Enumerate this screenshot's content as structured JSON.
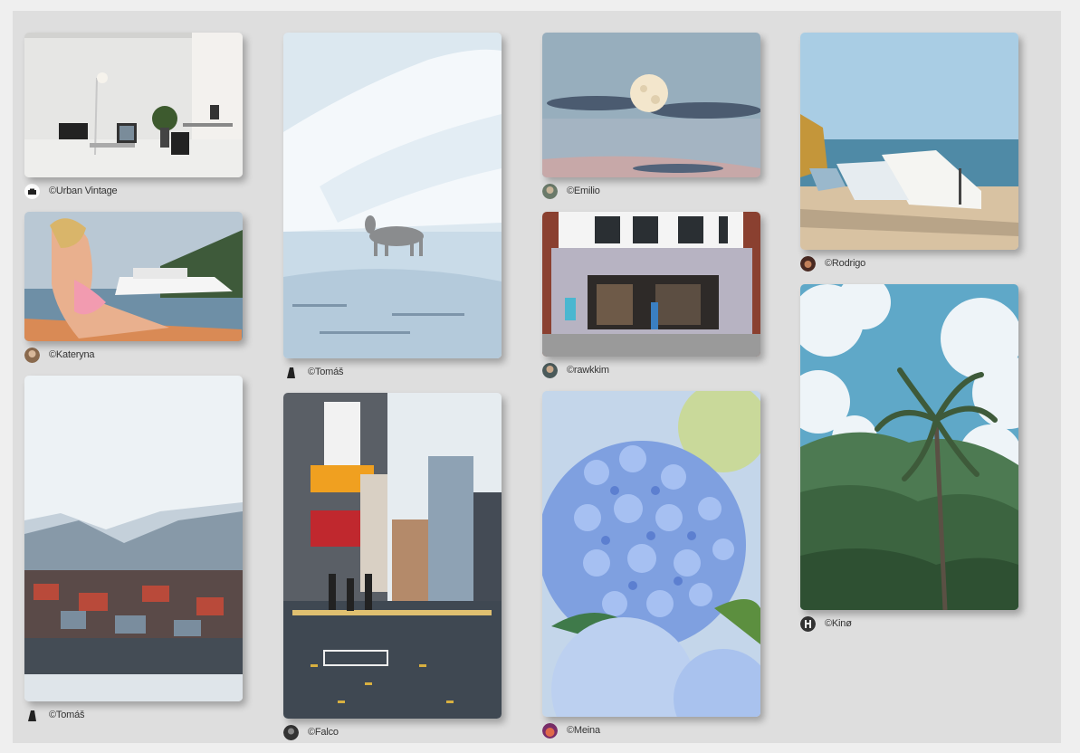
{
  "gallery": {
    "columns": [
      {
        "items": [
          {
            "alt": "White studio interior with lamp, chairs, plant and desk",
            "credit": "©Urban Vintage",
            "avatar": "camera-logo-icon"
          },
          {
            "alt": "Woman in pink bikini on boat near white yacht",
            "credit": "©Kateryna",
            "avatar": "portrait-avatar"
          },
          {
            "alt": "Colorful houses below snowy mountains",
            "credit": "©Tomáš",
            "avatar": "portrait-avatar"
          }
        ]
      },
      {
        "items": [
          {
            "alt": "Reindeer on snowy arctic plain",
            "credit": "©Tomáš",
            "avatar": "portrait-avatar"
          },
          {
            "alt": "City street with signs and pedestrians",
            "credit": "©Falco",
            "avatar": "portrait-avatar"
          }
        ]
      },
      {
        "items": [
          {
            "alt": "Full moon above clouds at dusk",
            "credit": "©Emilio",
            "avatar": "portrait-avatar"
          },
          {
            "alt": "Cafe storefront with grey facade",
            "credit": "©rawkkim",
            "avatar": "portrait-avatar"
          },
          {
            "alt": "Blue hydrangea flowers",
            "credit": "©Meina",
            "avatar": "portrait-avatar"
          }
        ]
      },
      {
        "items": [
          {
            "alt": "Boats on beach by sea",
            "credit": "©Rodrigo",
            "avatar": "portrait-avatar"
          },
          {
            "alt": "Palm tree against green mountains and sky",
            "credit": "©Kinø",
            "avatar": "logo-avatar"
          }
        ]
      }
    ]
  }
}
